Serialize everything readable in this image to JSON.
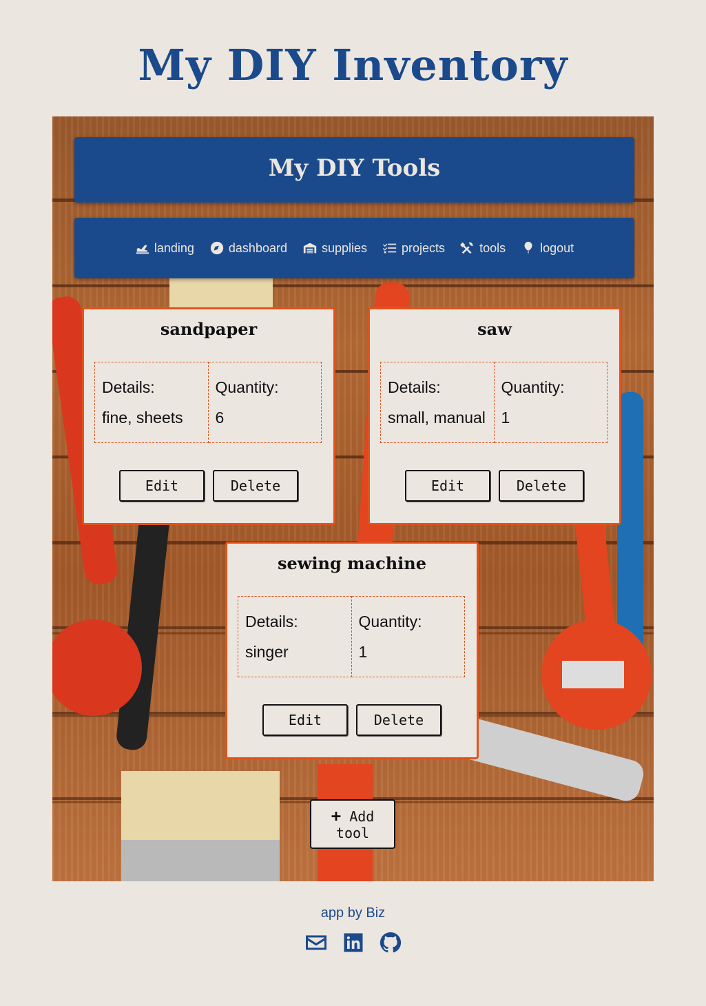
{
  "app": {
    "title": "My DIY Inventory"
  },
  "page": {
    "heading": "My DIY Tools"
  },
  "nav": [
    {
      "label": "landing",
      "icon": "plane-icon"
    },
    {
      "label": "dashboard",
      "icon": "compass-icon"
    },
    {
      "label": "supplies",
      "icon": "warehouse-icon"
    },
    {
      "label": "projects",
      "icon": "checklist-icon"
    },
    {
      "label": "tools",
      "icon": "tools-icon"
    },
    {
      "label": "logout",
      "icon": "balloon-icon"
    }
  ],
  "labels": {
    "details": "Details:",
    "quantity": "Quantity:",
    "edit": "Edit",
    "delete": "Delete"
  },
  "tools": [
    {
      "name": "sandpaper",
      "details": "fine, sheets",
      "quantity": "6"
    },
    {
      "name": "saw",
      "details": "small, manual",
      "quantity": "1"
    },
    {
      "name": "sewing machine",
      "details": "singer",
      "quantity": "1"
    }
  ],
  "add_button": {
    "line1": "Add",
    "line2": "tool",
    "icon": "plus-icon"
  },
  "footer": {
    "credit": "app by Biz",
    "icons": [
      "envelope-icon",
      "linkedin-icon",
      "github-icon"
    ]
  },
  "colors": {
    "brand_blue": "#1a4a8c",
    "accent_orange": "#e2531b",
    "background": "#ece6e1"
  }
}
